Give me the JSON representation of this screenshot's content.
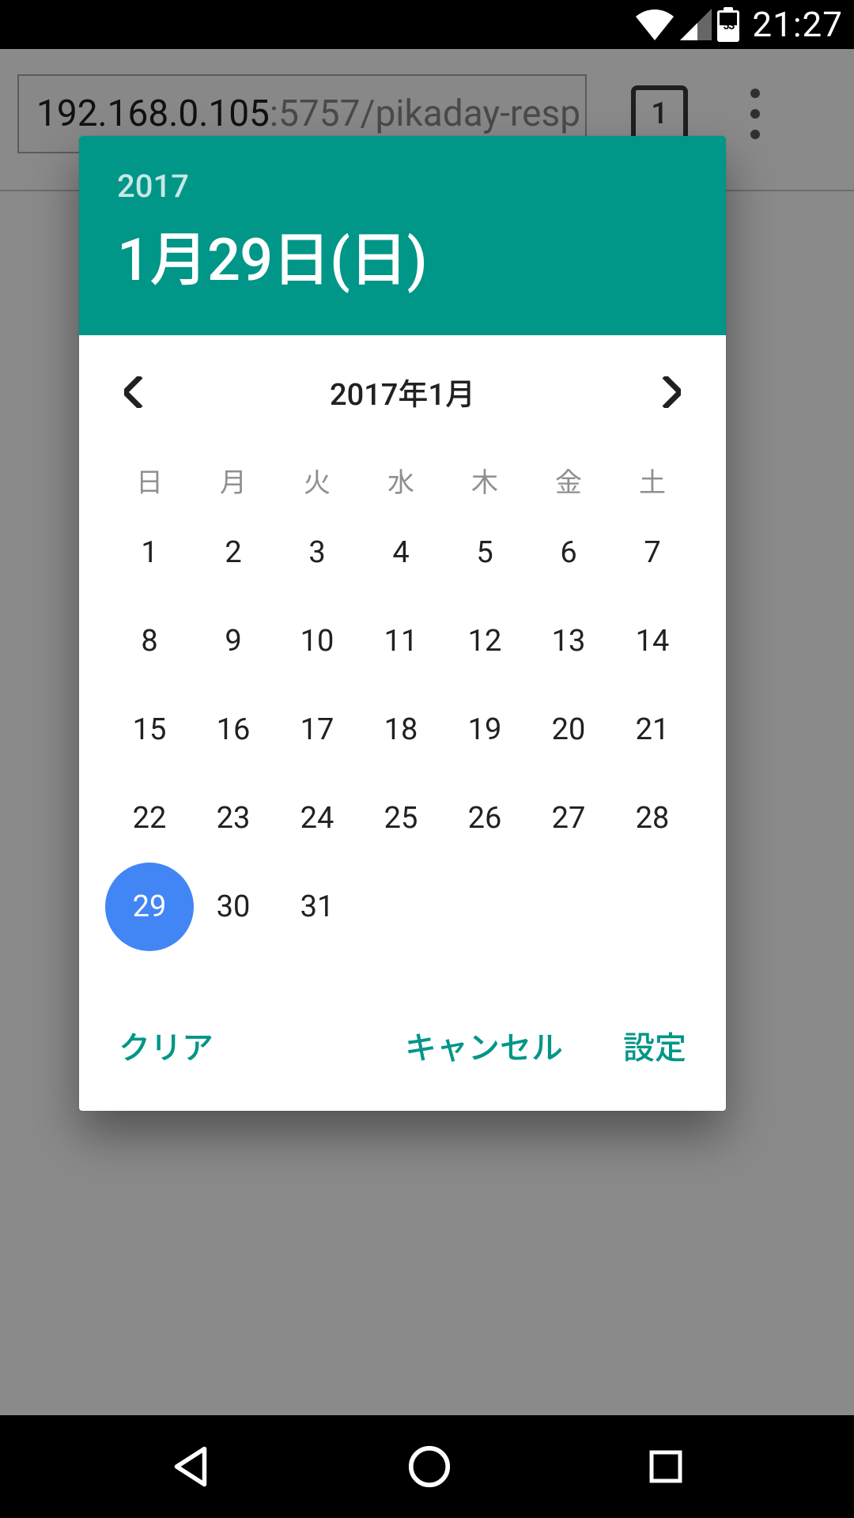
{
  "status": {
    "battery_text": "53",
    "clock": "21:27"
  },
  "browser": {
    "url_prefix": "192.168.0.105",
    "url_suffix": ":5757/pikaday-resp",
    "tab_count": "1"
  },
  "picker": {
    "header_year": "2017",
    "header_date": "1月29日(日)",
    "month_label": "2017年1月",
    "dow": [
      "日",
      "月",
      "火",
      "水",
      "木",
      "金",
      "土"
    ],
    "weeks": [
      [
        "1",
        "2",
        "3",
        "4",
        "5",
        "6",
        "7"
      ],
      [
        "8",
        "9",
        "10",
        "11",
        "12",
        "13",
        "14"
      ],
      [
        "15",
        "16",
        "17",
        "18",
        "19",
        "20",
        "21"
      ],
      [
        "22",
        "23",
        "24",
        "25",
        "26",
        "27",
        "28"
      ],
      [
        "29",
        "30",
        "31",
        "",
        "",
        "",
        ""
      ]
    ],
    "selected_day": "29",
    "actions": {
      "clear": "クリア",
      "cancel": "キャンセル",
      "set": "設定"
    }
  }
}
